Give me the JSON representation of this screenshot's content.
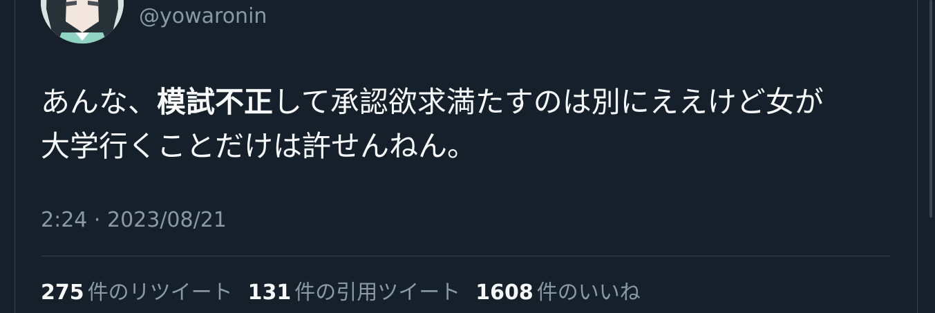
{
  "user": {
    "handle": "@yowaronin"
  },
  "tweet": {
    "text_before": "あんな、",
    "text_bold": "模試不正",
    "text_after": "して承認欲求満たすのは別にええけど女が\n大学行くことだけは許せんねん。",
    "timestamp": "2:24 · 2023/08/21"
  },
  "stats": {
    "retweets": {
      "count": "275",
      "label": "件のリツイート"
    },
    "quotes": {
      "count": "131",
      "label": "件の引用ツイート"
    },
    "likes": {
      "count": "1608",
      "label": "件のいいね"
    }
  },
  "colors": {
    "background": "#15202b",
    "primary_text": "#f7f9f9",
    "secondary_text": "#8b98a5",
    "border": "#38444d"
  }
}
